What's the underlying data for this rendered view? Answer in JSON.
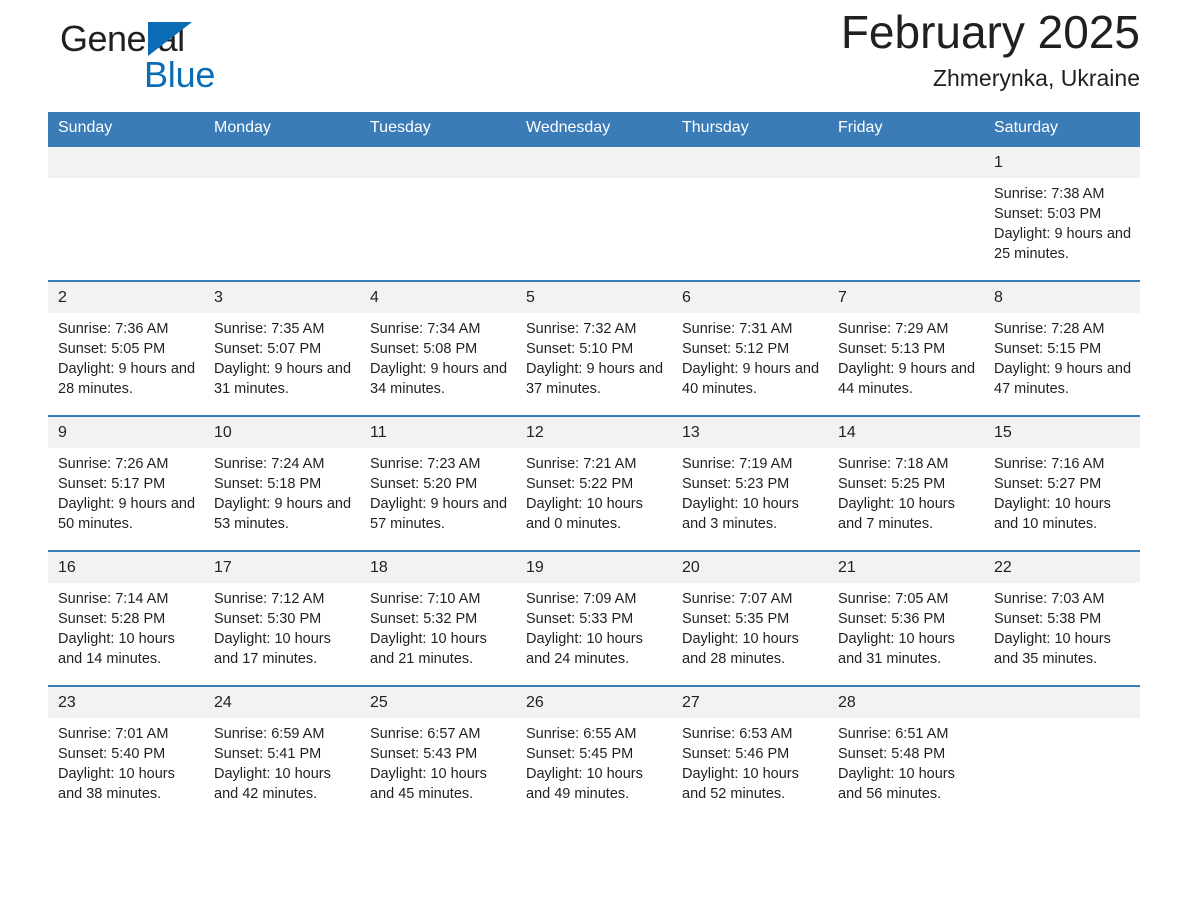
{
  "logo": {
    "word_general": "General",
    "word_blue": "Blue",
    "triangle_color": "#0a6cb4"
  },
  "header": {
    "title": "February 2025",
    "subtitle": "Zhmerynka, Ukraine"
  },
  "theme": {
    "header_blue": "#3b7cb8",
    "daynum_bg": "#f2f2f2",
    "text": "#231f20"
  },
  "labels": {
    "sunrise_prefix": "Sunrise:",
    "sunset_prefix": "Sunset:",
    "daylight_prefix": "Daylight:"
  },
  "weekday_headers": [
    "Sunday",
    "Monday",
    "Tuesday",
    "Wednesday",
    "Thursday",
    "Friday",
    "Saturday"
  ],
  "weeks": [
    [
      {
        "day": "",
        "sunrise": "",
        "sunset": "",
        "daylight": ""
      },
      {
        "day": "",
        "sunrise": "",
        "sunset": "",
        "daylight": ""
      },
      {
        "day": "",
        "sunrise": "",
        "sunset": "",
        "daylight": ""
      },
      {
        "day": "",
        "sunrise": "",
        "sunset": "",
        "daylight": ""
      },
      {
        "day": "",
        "sunrise": "",
        "sunset": "",
        "daylight": ""
      },
      {
        "day": "",
        "sunrise": "",
        "sunset": "",
        "daylight": ""
      },
      {
        "day": "1",
        "sunrise": "Sunrise: 7:38 AM",
        "sunset": "Sunset: 5:03 PM",
        "daylight": "Daylight: 9 hours and 25 minutes."
      }
    ],
    [
      {
        "day": "2",
        "sunrise": "Sunrise: 7:36 AM",
        "sunset": "Sunset: 5:05 PM",
        "daylight": "Daylight: 9 hours and 28 minutes."
      },
      {
        "day": "3",
        "sunrise": "Sunrise: 7:35 AM",
        "sunset": "Sunset: 5:07 PM",
        "daylight": "Daylight: 9 hours and 31 minutes."
      },
      {
        "day": "4",
        "sunrise": "Sunrise: 7:34 AM",
        "sunset": "Sunset: 5:08 PM",
        "daylight": "Daylight: 9 hours and 34 minutes."
      },
      {
        "day": "5",
        "sunrise": "Sunrise: 7:32 AM",
        "sunset": "Sunset: 5:10 PM",
        "daylight": "Daylight: 9 hours and 37 minutes."
      },
      {
        "day": "6",
        "sunrise": "Sunrise: 7:31 AM",
        "sunset": "Sunset: 5:12 PM",
        "daylight": "Daylight: 9 hours and 40 minutes."
      },
      {
        "day": "7",
        "sunrise": "Sunrise: 7:29 AM",
        "sunset": "Sunset: 5:13 PM",
        "daylight": "Daylight: 9 hours and 44 minutes."
      },
      {
        "day": "8",
        "sunrise": "Sunrise: 7:28 AM",
        "sunset": "Sunset: 5:15 PM",
        "daylight": "Daylight: 9 hours and 47 minutes."
      }
    ],
    [
      {
        "day": "9",
        "sunrise": "Sunrise: 7:26 AM",
        "sunset": "Sunset: 5:17 PM",
        "daylight": "Daylight: 9 hours and 50 minutes."
      },
      {
        "day": "10",
        "sunrise": "Sunrise: 7:24 AM",
        "sunset": "Sunset: 5:18 PM",
        "daylight": "Daylight: 9 hours and 53 minutes."
      },
      {
        "day": "11",
        "sunrise": "Sunrise: 7:23 AM",
        "sunset": "Sunset: 5:20 PM",
        "daylight": "Daylight: 9 hours and 57 minutes."
      },
      {
        "day": "12",
        "sunrise": "Sunrise: 7:21 AM",
        "sunset": "Sunset: 5:22 PM",
        "daylight": "Daylight: 10 hours and 0 minutes."
      },
      {
        "day": "13",
        "sunrise": "Sunrise: 7:19 AM",
        "sunset": "Sunset: 5:23 PM",
        "daylight": "Daylight: 10 hours and 3 minutes."
      },
      {
        "day": "14",
        "sunrise": "Sunrise: 7:18 AM",
        "sunset": "Sunset: 5:25 PM",
        "daylight": "Daylight: 10 hours and 7 minutes."
      },
      {
        "day": "15",
        "sunrise": "Sunrise: 7:16 AM",
        "sunset": "Sunset: 5:27 PM",
        "daylight": "Daylight: 10 hours and 10 minutes."
      }
    ],
    [
      {
        "day": "16",
        "sunrise": "Sunrise: 7:14 AM",
        "sunset": "Sunset: 5:28 PM",
        "daylight": "Daylight: 10 hours and 14 minutes."
      },
      {
        "day": "17",
        "sunrise": "Sunrise: 7:12 AM",
        "sunset": "Sunset: 5:30 PM",
        "daylight": "Daylight: 10 hours and 17 minutes."
      },
      {
        "day": "18",
        "sunrise": "Sunrise: 7:10 AM",
        "sunset": "Sunset: 5:32 PM",
        "daylight": "Daylight: 10 hours and 21 minutes."
      },
      {
        "day": "19",
        "sunrise": "Sunrise: 7:09 AM",
        "sunset": "Sunset: 5:33 PM",
        "daylight": "Daylight: 10 hours and 24 minutes."
      },
      {
        "day": "20",
        "sunrise": "Sunrise: 7:07 AM",
        "sunset": "Sunset: 5:35 PM",
        "daylight": "Daylight: 10 hours and 28 minutes."
      },
      {
        "day": "21",
        "sunrise": "Sunrise: 7:05 AM",
        "sunset": "Sunset: 5:36 PM",
        "daylight": "Daylight: 10 hours and 31 minutes."
      },
      {
        "day": "22",
        "sunrise": "Sunrise: 7:03 AM",
        "sunset": "Sunset: 5:38 PM",
        "daylight": "Daylight: 10 hours and 35 minutes."
      }
    ],
    [
      {
        "day": "23",
        "sunrise": "Sunrise: 7:01 AM",
        "sunset": "Sunset: 5:40 PM",
        "daylight": "Daylight: 10 hours and 38 minutes."
      },
      {
        "day": "24",
        "sunrise": "Sunrise: 6:59 AM",
        "sunset": "Sunset: 5:41 PM",
        "daylight": "Daylight: 10 hours and 42 minutes."
      },
      {
        "day": "25",
        "sunrise": "Sunrise: 6:57 AM",
        "sunset": "Sunset: 5:43 PM",
        "daylight": "Daylight: 10 hours and 45 minutes."
      },
      {
        "day": "26",
        "sunrise": "Sunrise: 6:55 AM",
        "sunset": "Sunset: 5:45 PM",
        "daylight": "Daylight: 10 hours and 49 minutes."
      },
      {
        "day": "27",
        "sunrise": "Sunrise: 6:53 AM",
        "sunset": "Sunset: 5:46 PM",
        "daylight": "Daylight: 10 hours and 52 minutes."
      },
      {
        "day": "28",
        "sunrise": "Sunrise: 6:51 AM",
        "sunset": "Sunset: 5:48 PM",
        "daylight": "Daylight: 10 hours and 56 minutes."
      },
      {
        "day": "",
        "sunrise": "",
        "sunset": "",
        "daylight": ""
      }
    ]
  ]
}
